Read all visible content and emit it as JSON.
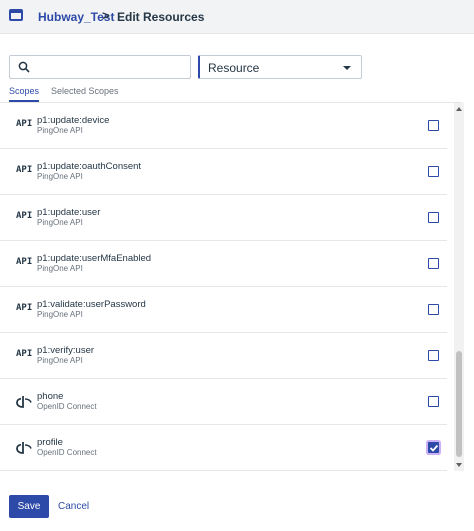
{
  "header": {
    "app_icon": "window-icon",
    "breadcrumb_parent": "Hubway_Test",
    "breadcrumb_separator": ">",
    "breadcrumb_current": "Edit Resources"
  },
  "filters": {
    "search_value": "",
    "search_placeholder": "",
    "resource_selected": "Resource"
  },
  "tabs": [
    {
      "label": "Scopes",
      "active": true
    },
    {
      "label": "Selected Scopes",
      "active": false
    }
  ],
  "scopes": [
    {
      "name": "p1:update:device",
      "resource": "PingOne API",
      "icon": "api-icon",
      "icon_text": "API",
      "checked": false
    },
    {
      "name": "p1:update:oauthConsent",
      "resource": "PingOne API",
      "icon": "api-icon",
      "icon_text": "API",
      "checked": false
    },
    {
      "name": "p1:update:user",
      "resource": "PingOne API",
      "icon": "api-icon",
      "icon_text": "API",
      "checked": false
    },
    {
      "name": "p1:update:userMfaEnabled",
      "resource": "PingOne API",
      "icon": "api-icon",
      "icon_text": "API",
      "checked": false
    },
    {
      "name": "p1:validate:userPassword",
      "resource": "PingOne API",
      "icon": "api-icon",
      "icon_text": "API",
      "checked": false
    },
    {
      "name": "p1:verify:user",
      "resource": "PingOne API",
      "icon": "api-icon",
      "icon_text": "API",
      "checked": false
    },
    {
      "name": "phone",
      "resource": "OpenID Connect",
      "icon": "openid-icon",
      "icon_text": "",
      "checked": false
    },
    {
      "name": "profile",
      "resource": "OpenID Connect",
      "icon": "openid-icon",
      "icon_text": "",
      "checked": true
    }
  ],
  "footer": {
    "save_label": "Save",
    "cancel_label": "Cancel"
  },
  "colors": {
    "accent": "#2d4aa8",
    "text": "#253746",
    "muted": "#68717c",
    "checked_focus": "#c9b0f7"
  }
}
